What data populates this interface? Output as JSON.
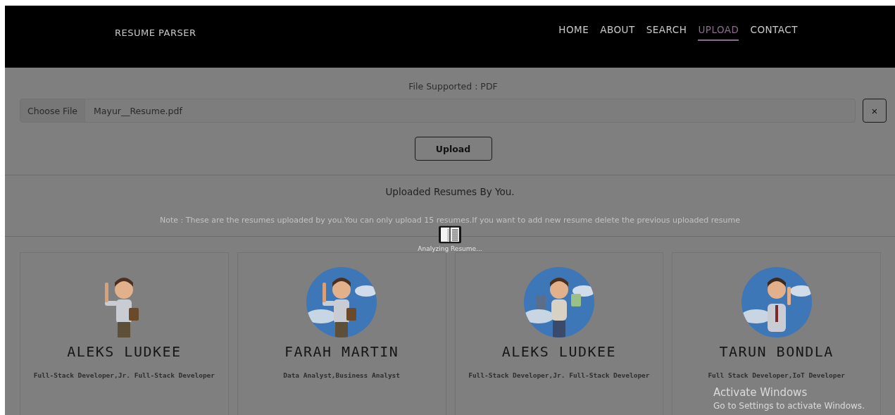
{
  "navbar": {
    "brand": "RESUME PARSER",
    "items": [
      {
        "label": "HOME",
        "selected": false
      },
      {
        "label": "ABOUT",
        "selected": false
      },
      {
        "label": "SEARCH",
        "selected": false
      },
      {
        "label": "UPLOAD",
        "selected": true
      },
      {
        "label": "CONTACT",
        "selected": false
      }
    ]
  },
  "upload_form": {
    "supported": "File Supported : PDF",
    "choose_button": "Choose File",
    "file_name": "Mayur__Resume.pdf",
    "clear_button": "×",
    "upload_button": "Upload"
  },
  "uploaded_section": {
    "title": "Uploaded Resumes By You.",
    "note": "Note : These are the resumes uploaded by you.You can only upload 15 resumes.If you want to add new resume delete the previous uploaded resume"
  },
  "loader": {
    "text": "Analyzing Resume..."
  },
  "cards": [
    {
      "name": "ALEKS LUDKEE",
      "roles": "Full-Stack Developer,Jr. Full-Stack Developer",
      "round_photo": false
    },
    {
      "name": "FARAH MARTIN",
      "roles": "Data Analyst,Business Analyst",
      "round_photo": true
    },
    {
      "name": "ALEKS LUDKEE",
      "roles": "Full-Stack Developer,Jr. Full-Stack Developer",
      "round_photo": true
    },
    {
      "name": "TARUN BONDLA",
      "roles": "Full Stack Developer,IoT Developer",
      "round_photo": true
    }
  ],
  "os_notice": {
    "title": "Activate Windows",
    "subtitle": "Go to Settings to activate Windows."
  }
}
